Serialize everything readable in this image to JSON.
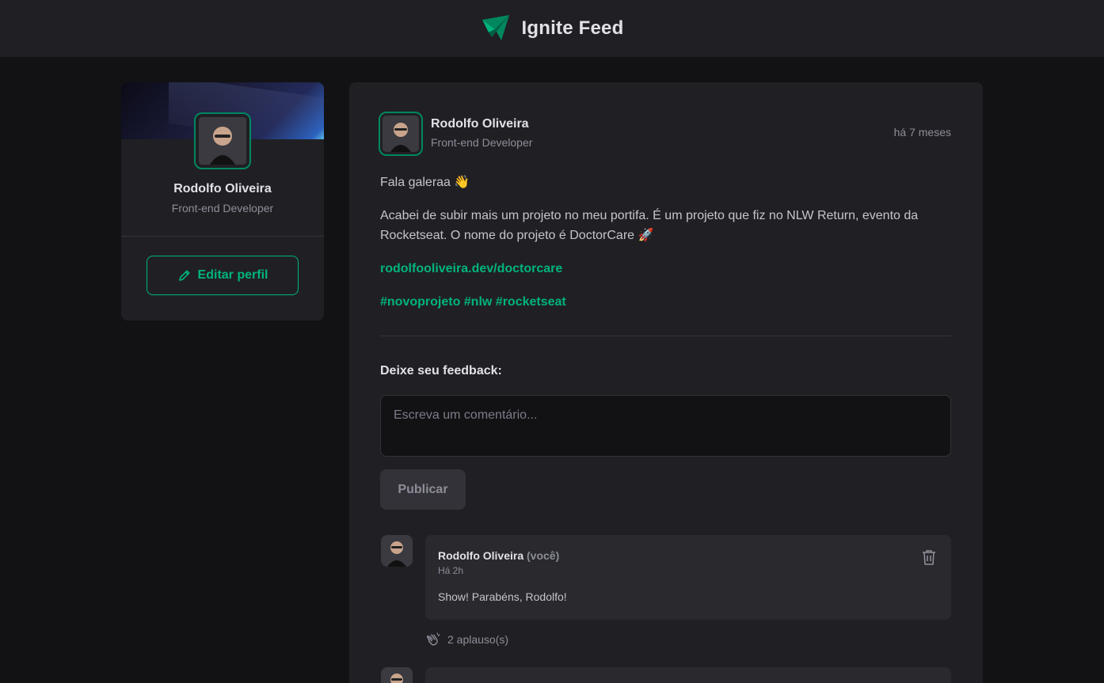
{
  "header": {
    "title": "Ignite Feed",
    "logo_icon": "paper-plane-icon",
    "accent": "#00875f"
  },
  "sidebar": {
    "name": "Rodolfo Oliveira",
    "role": "Front-end Developer",
    "edit_label": "Editar perfil",
    "edit_icon": "pencil-icon"
  },
  "post": {
    "author": {
      "name": "Rodolfo Oliveira",
      "role": "Front-end Developer"
    },
    "time": "há 7 meses",
    "paragraphs": [
      "Fala galeraa 👋",
      "Acabei de subir mais um projeto no meu portifa. É um projeto que fiz no NLW Return, evento da Rocketseat. O nome do projeto é DoctorCare 🚀"
    ],
    "link": "rodolfooliveira.dev/doctorcare",
    "hashtags": "#novoprojeto #nlw #rocketseat",
    "feedback_label": "Deixe seu feedback:",
    "comment_placeholder": "Escreva um comentário...",
    "publish_label": "Publicar"
  },
  "comments": [
    {
      "author": "Rodolfo Oliveira",
      "you": "(você)",
      "time": "Há 2h",
      "text": "Show! Parabéns, Rodolfo!",
      "applause": "2 aplauso(s)"
    }
  ]
}
